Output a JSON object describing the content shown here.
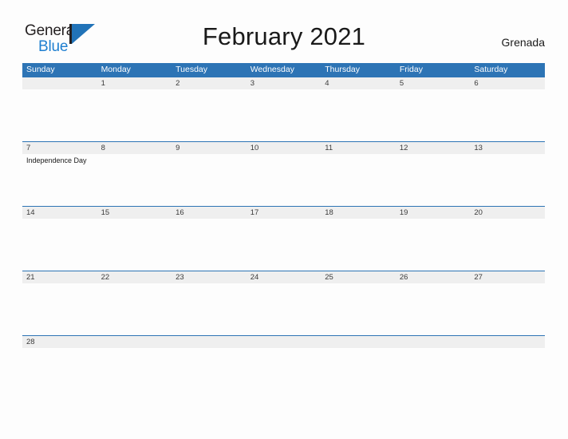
{
  "brand": {
    "name_part1": "General",
    "name_part2": "Blue",
    "mark_icon": "sail-triangle-icon",
    "accent_color": "#1f7fd0"
  },
  "header": {
    "title": "February 2021",
    "locale": "Grenada"
  },
  "theme": {
    "header_blue": "#2d74b5",
    "band_gray": "#efefef",
    "page_background": "#fdfdfd",
    "text_color": "#1a1a1a"
  },
  "calendar": {
    "month": "February",
    "year": "2021",
    "weekdays": [
      "Sunday",
      "Monday",
      "Tuesday",
      "Wednesday",
      "Thursday",
      "Friday",
      "Saturday"
    ],
    "weeks": [
      [
        {
          "day": "",
          "events": []
        },
        {
          "day": "1",
          "events": []
        },
        {
          "day": "2",
          "events": []
        },
        {
          "day": "3",
          "events": []
        },
        {
          "day": "4",
          "events": []
        },
        {
          "day": "5",
          "events": []
        },
        {
          "day": "6",
          "events": []
        }
      ],
      [
        {
          "day": "7",
          "events": [
            "Independence Day"
          ]
        },
        {
          "day": "8",
          "events": []
        },
        {
          "day": "9",
          "events": []
        },
        {
          "day": "10",
          "events": []
        },
        {
          "day": "11",
          "events": []
        },
        {
          "day": "12",
          "events": []
        },
        {
          "day": "13",
          "events": []
        }
      ],
      [
        {
          "day": "14",
          "events": []
        },
        {
          "day": "15",
          "events": []
        },
        {
          "day": "16",
          "events": []
        },
        {
          "day": "17",
          "events": []
        },
        {
          "day": "18",
          "events": []
        },
        {
          "day": "19",
          "events": []
        },
        {
          "day": "20",
          "events": []
        }
      ],
      [
        {
          "day": "21",
          "events": []
        },
        {
          "day": "22",
          "events": []
        },
        {
          "day": "23",
          "events": []
        },
        {
          "day": "24",
          "events": []
        },
        {
          "day": "25",
          "events": []
        },
        {
          "day": "26",
          "events": []
        },
        {
          "day": "27",
          "events": []
        }
      ],
      [
        {
          "day": "28",
          "events": []
        },
        {
          "day": "",
          "events": []
        },
        {
          "day": "",
          "events": []
        },
        {
          "day": "",
          "events": []
        },
        {
          "day": "",
          "events": []
        },
        {
          "day": "",
          "events": []
        },
        {
          "day": "",
          "events": []
        }
      ]
    ]
  }
}
